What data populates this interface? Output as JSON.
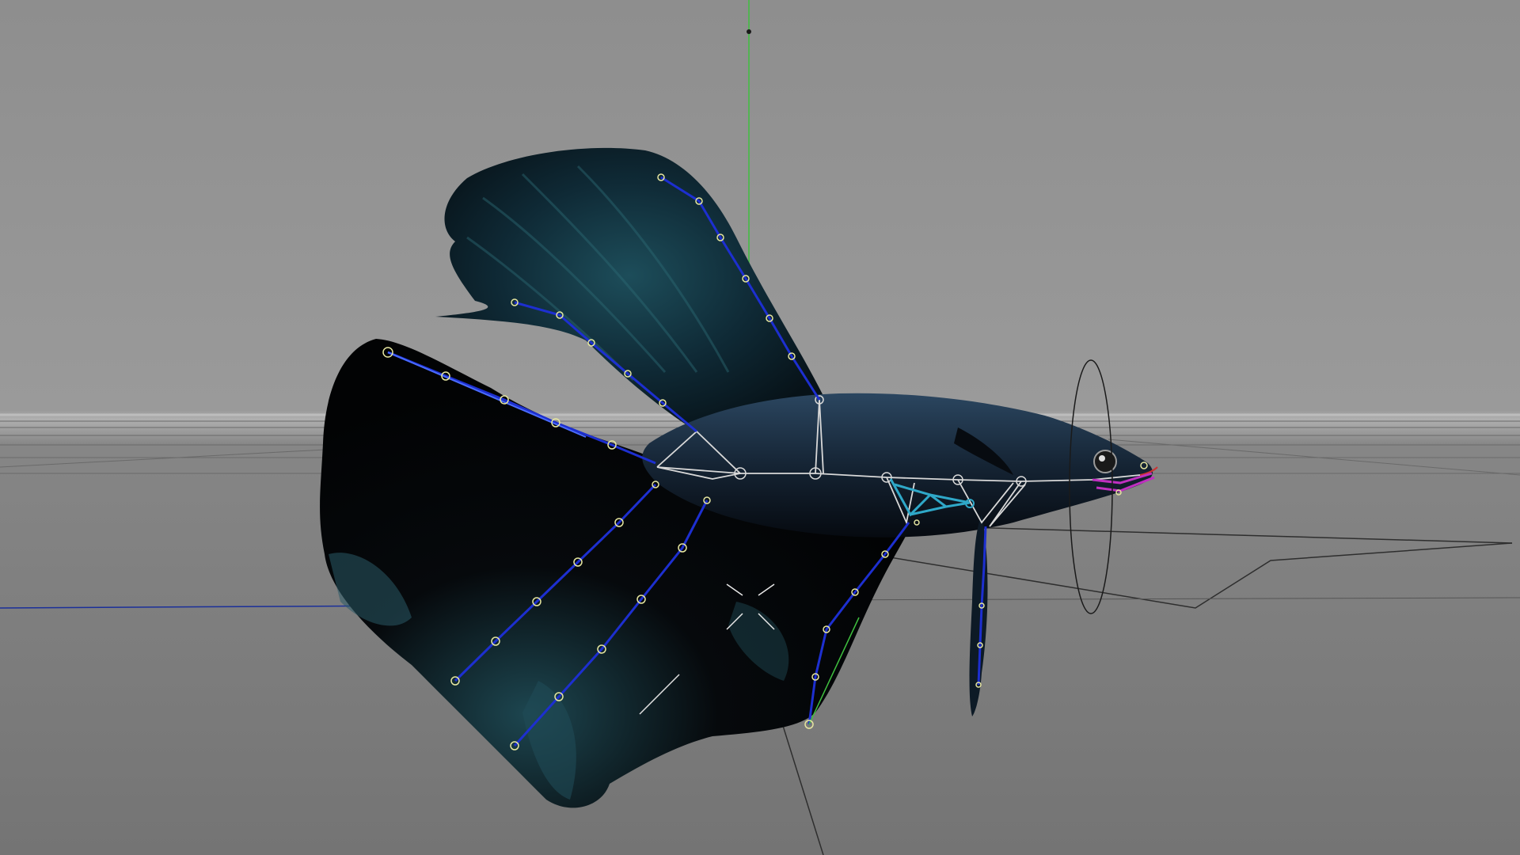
{
  "viewport": {
    "background_top": "#8e8e8e",
    "background_horizon": "#a8a8a8",
    "background_bottom": "#777777",
    "grid_color": "#5a5a5a"
  },
  "axes": {
    "y_axis_color": "#3fbf3f",
    "x_axis_color": "#1a2f9a",
    "z_axis_color": "#3a3a3a"
  },
  "rig": {
    "spine_bone_color": "#d8d8d8",
    "fin_bone_color": "#1d2fd0",
    "fin_joint_color": "#e6e6a0",
    "pectoral_bone_color": "#2fa8c8",
    "mouth_bone_color": "#c030c0"
  },
  "fish": {
    "body_color": "#0e1620",
    "fin_color": "#0a1a22",
    "scale_highlight": "#2f6e78"
  },
  "icons": {
    "object_pivot": "crosshair-icon",
    "rotate_gizmo": "rotate-ring-icon"
  }
}
